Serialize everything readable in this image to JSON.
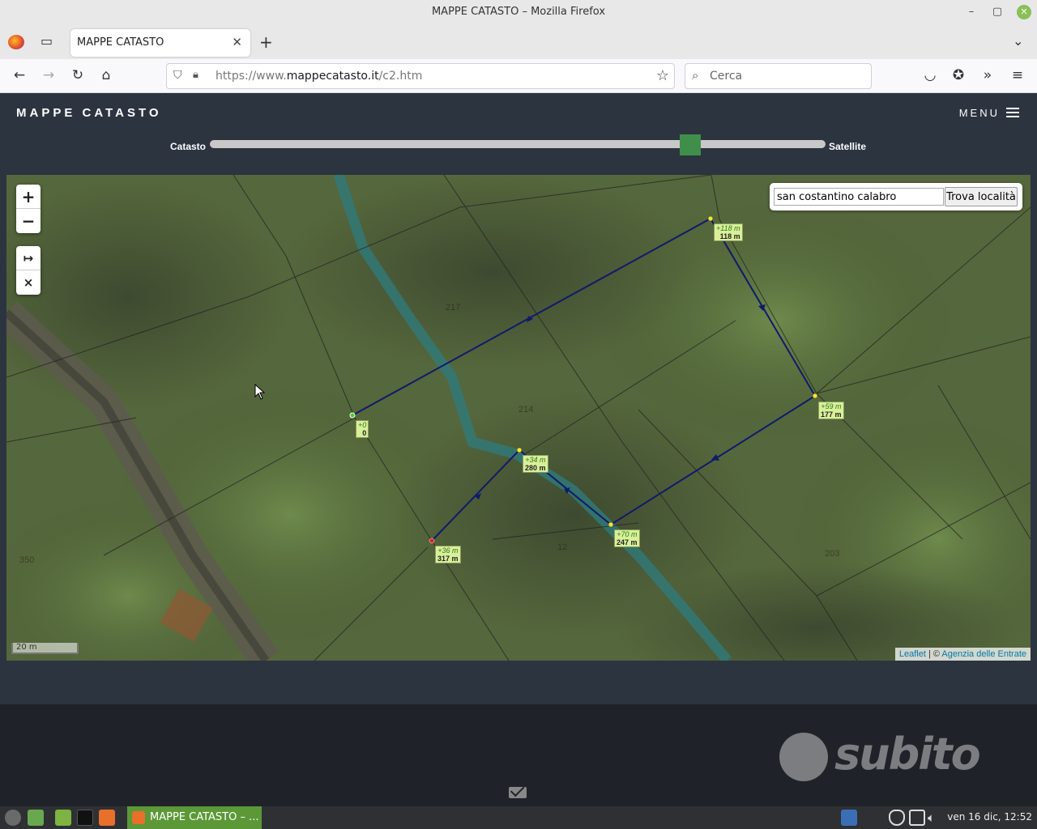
{
  "window": {
    "title": "MAPPE CATASTO – Mozilla Firefox"
  },
  "tab": {
    "title": "MAPPE CATASTO"
  },
  "nav": {
    "url_prefix": "https://www.",
    "url_domain": "mappecatasto.it",
    "url_path": "/c2.htm",
    "search_placeholder": "Cerca"
  },
  "site": {
    "brand": "MAPPE CATASTO",
    "menu_label": "MENU",
    "slider": {
      "left_label": "Catasto",
      "right_label": "Satellite",
      "value": 0.78
    }
  },
  "map": {
    "search_value": "san costantino calabro",
    "search_button": "Trova località",
    "zoom_in": "+",
    "zoom_out": "−",
    "measure_icon": "↦",
    "clear_icon": "×",
    "scale": "20 m",
    "attribution": {
      "leaflet": "Leaflet",
      "separator": " | © ",
      "provider": "Agenzia delle Entrate"
    },
    "measure_points": [
      {
        "elev": "+0",
        "dist": "0"
      },
      {
        "elev": "+118 m",
        "dist": "118 m"
      },
      {
        "elev": "+59 m",
        "dist": "177 m"
      },
      {
        "elev": "+70 m",
        "dist": "247 m"
      },
      {
        "elev": "+34 m",
        "dist": "280 m"
      },
      {
        "elev": "+36 m",
        "dist": "317 m"
      }
    ],
    "parcels": [
      "217",
      "214",
      "12",
      "203",
      "350"
    ]
  },
  "taskbar": {
    "task_label": "MAPPE CATASTO – ...",
    "clock": "ven 16 dic, 12:52"
  },
  "watermark": "subito",
  "colors": {
    "header_bg": "#2c3440",
    "slider_thumb": "#3f8f4a",
    "route": "#101a6a",
    "label_bg": "#d9ef9a"
  }
}
